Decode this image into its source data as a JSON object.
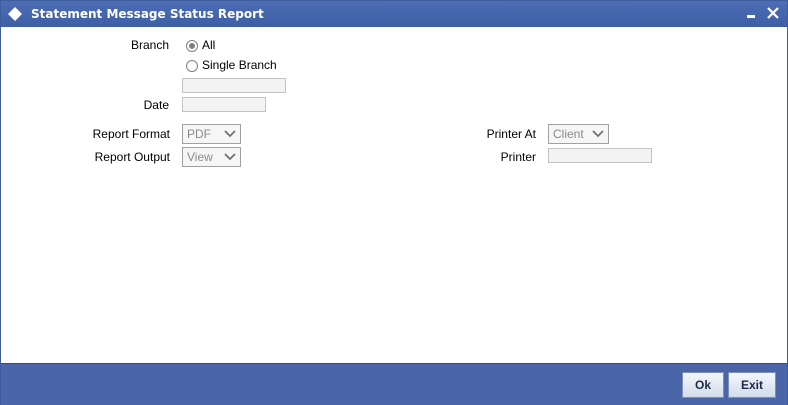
{
  "window": {
    "title": "Statement Message Status Report"
  },
  "form": {
    "branch": {
      "label": "Branch",
      "options": [
        "All",
        "Single Branch"
      ],
      "selected": "All",
      "single_branch_value": ""
    },
    "date": {
      "label": "Date",
      "value": ""
    },
    "report_format": {
      "label": "Report Format",
      "value": "PDF"
    },
    "report_output": {
      "label": "Report Output",
      "value": "View"
    },
    "printer_at": {
      "label": "Printer At",
      "value": "Client"
    },
    "printer": {
      "label": "Printer",
      "value": ""
    }
  },
  "footer": {
    "ok_label": "Ok",
    "exit_label": "Exit"
  },
  "icons": {
    "title": "diamond-icon",
    "minimize": "minimize-icon",
    "close": "close-icon",
    "dropdown": "chevron-down-icon"
  },
  "colors": {
    "titlebar": "#4c6db5",
    "footer": "#4a66a8"
  }
}
